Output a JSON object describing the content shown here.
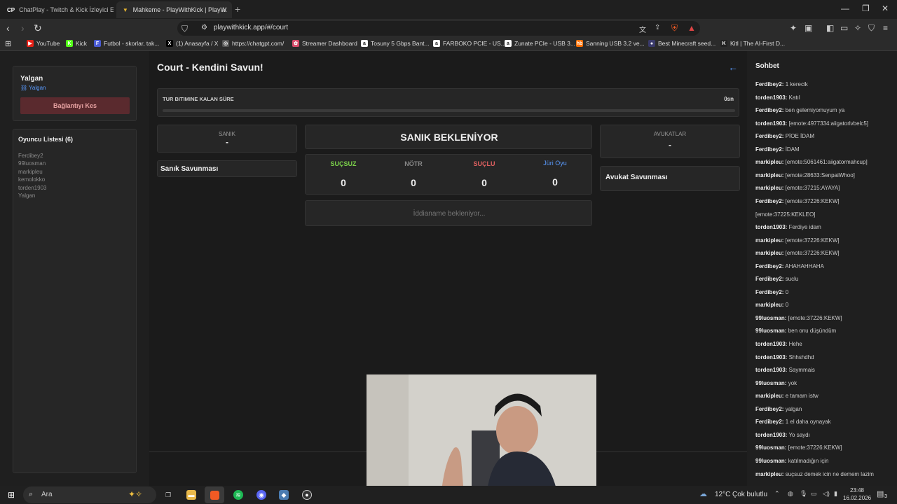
{
  "browser": {
    "tabs": [
      {
        "icon": "CP",
        "label": "ChatPlay - Twitch & Kick İzleyici Etkil"
      },
      {
        "icon": "▼",
        "label": "Mahkeme - PlayWithKick | PlayW"
      }
    ],
    "url": "playwithkick.app/#/court",
    "bookmarks": [
      {
        "icon": "▶",
        "label": "YouTube",
        "color": "#e62117"
      },
      {
        "icon": "K",
        "label": "Kick",
        "color": "#53fc18"
      },
      {
        "icon": "F",
        "label": "Futbol - skorlar, tak...",
        "color": "#4a5bd4"
      },
      {
        "icon": "X",
        "label": "(1) Anasayfa / X",
        "color": "#000000"
      },
      {
        "icon": "◎",
        "label": "https://chatgpt.com/",
        "color": "#555555"
      },
      {
        "icon": "✿",
        "label": "Streamer Dashboard",
        "color": "#d64c6a"
      },
      {
        "icon": "a",
        "label": "Tosuny 5 Gbps Bant...",
        "color": "#ffffff"
      },
      {
        "icon": "a",
        "label": "FARBOKO PCIE - US...",
        "color": "#ffffff"
      },
      {
        "icon": "a",
        "label": "Zunate PCIe - USB 3...",
        "color": "#ffffff"
      },
      {
        "icon": "hb",
        "label": "Sanning USB 3.2 ve...",
        "color": "#ff6f00"
      },
      {
        "icon": "●",
        "label": "Best Minecraft seed...",
        "color": "#3a3a6a"
      },
      {
        "icon": "K",
        "label": "Kitl | The AI-First D...",
        "color": "#222222"
      }
    ]
  },
  "left": {
    "user_name": "Yalgan",
    "user_sub": "Yalgan",
    "disconnect": "Bağlantıyı Kes",
    "players_title": "Oyuncu Listesi (6)",
    "players": [
      "Ferdibey2",
      "99luosman",
      "markipleu",
      "kemolokko",
      "torden1903",
      "Yalgan"
    ]
  },
  "main": {
    "title": "Court - Kendini Savun!",
    "timer_label": "TUR BITIMINE KALAN SÜRE",
    "timer_value": "0sn",
    "timer_progress": 0,
    "defendant_label": "SANIK",
    "defendant_value": "-",
    "defendant_defense": "Sanık Savunması",
    "status": "SANIK BEKLENİYOR",
    "votes": [
      {
        "label": "SUÇSUZ",
        "value": "0",
        "color": "#7bd14a"
      },
      {
        "label": "NÖTR",
        "value": "0",
        "color": "#888888"
      },
      {
        "label": "SUÇLU",
        "value": "0",
        "color": "#e06060"
      },
      {
        "label": "Jüri Oyu",
        "value": "0",
        "color": "#5a9bff"
      }
    ],
    "indictment_placeholder": "İddianame bekleniyor...",
    "lawyers_label": "AVUKATLAR",
    "lawyers_value": "-",
    "lawyer_defense": "Avukat Savunması"
  },
  "chat": {
    "title": "Sohbet",
    "messages": [
      {
        "user": "Ferdibey2:",
        "text": "1 kerecik"
      },
      {
        "user": "torden1903:",
        "text": "Katıl"
      },
      {
        "user": "Ferdibey2:",
        "text": "ben gelemiyomuyum ya"
      },
      {
        "user": "torden1903:",
        "text": "[emote:4977334:aiigatorlvbelc5]"
      },
      {
        "user": "Ferdibey2:",
        "text": "PİOE İDAM"
      },
      {
        "user": "Ferdibey2:",
        "text": "İDAM"
      },
      {
        "user": "markipleu:",
        "text": "[emote:5061461:aiigatormahcup]"
      },
      {
        "user": "markipleu:",
        "text": "[emote:28633:SenpaiWhoo]"
      },
      {
        "user": "markipleu:",
        "text": "[emote:37215:AYAYA]"
      },
      {
        "user": "Ferdibey2:",
        "text": "[emote:37226:KEKW]"
      },
      {
        "user": "",
        "text": "[emote:37225:KEKLEO]"
      },
      {
        "user": "torden1903:",
        "text": "Ferdiye idam"
      },
      {
        "user": "markipleu:",
        "text": "[emote:37226:KEKW]"
      },
      {
        "user": "markipleu:",
        "text": "[emote:37226:KEKW]"
      },
      {
        "user": "Ferdibey2:",
        "text": "AHAHAHHAHA"
      },
      {
        "user": "Ferdibey2:",
        "text": "suclu"
      },
      {
        "user": "Ferdibey2:",
        "text": "0"
      },
      {
        "user": "markipleu:",
        "text": "0"
      },
      {
        "user": "99luosman:",
        "text": "[emote:37226:KEKW]"
      },
      {
        "user": "99luosman:",
        "text": "ben onu düşündüm"
      },
      {
        "user": "torden1903:",
        "text": "Hehe"
      },
      {
        "user": "torden1903:",
        "text": "Shhshdhd"
      },
      {
        "user": "torden1903:",
        "text": "Saymmais"
      },
      {
        "user": "99luosman:",
        "text": "yok"
      },
      {
        "user": "markipleu:",
        "text": "e tamam istw"
      },
      {
        "user": "Ferdibey2:",
        "text": "yalgan"
      },
      {
        "user": "Ferdibey2:",
        "text": "1 el daha oynayak"
      },
      {
        "user": "torden1903:",
        "text": "Yo saydı"
      },
      {
        "user": "99luosman:",
        "text": "[emote:37226:KEKW]"
      },
      {
        "user": "99luosman:",
        "text": "katılmadığın için"
      },
      {
        "user": "markipleu:",
        "text": "suçsuz demek icin ne demem lazim"
      }
    ]
  },
  "taskbar": {
    "search": "Ara",
    "weather_temp": "12°C",
    "weather_text": "Çok bulutlu",
    "time": "23:48",
    "date": "16.02.2026",
    "notif_count": "3"
  },
  "colors": {
    "disconnect_bg": "#5a2a2e",
    "disconnect_text": "#e8a3a3",
    "link_blue": "#5a9bff"
  }
}
